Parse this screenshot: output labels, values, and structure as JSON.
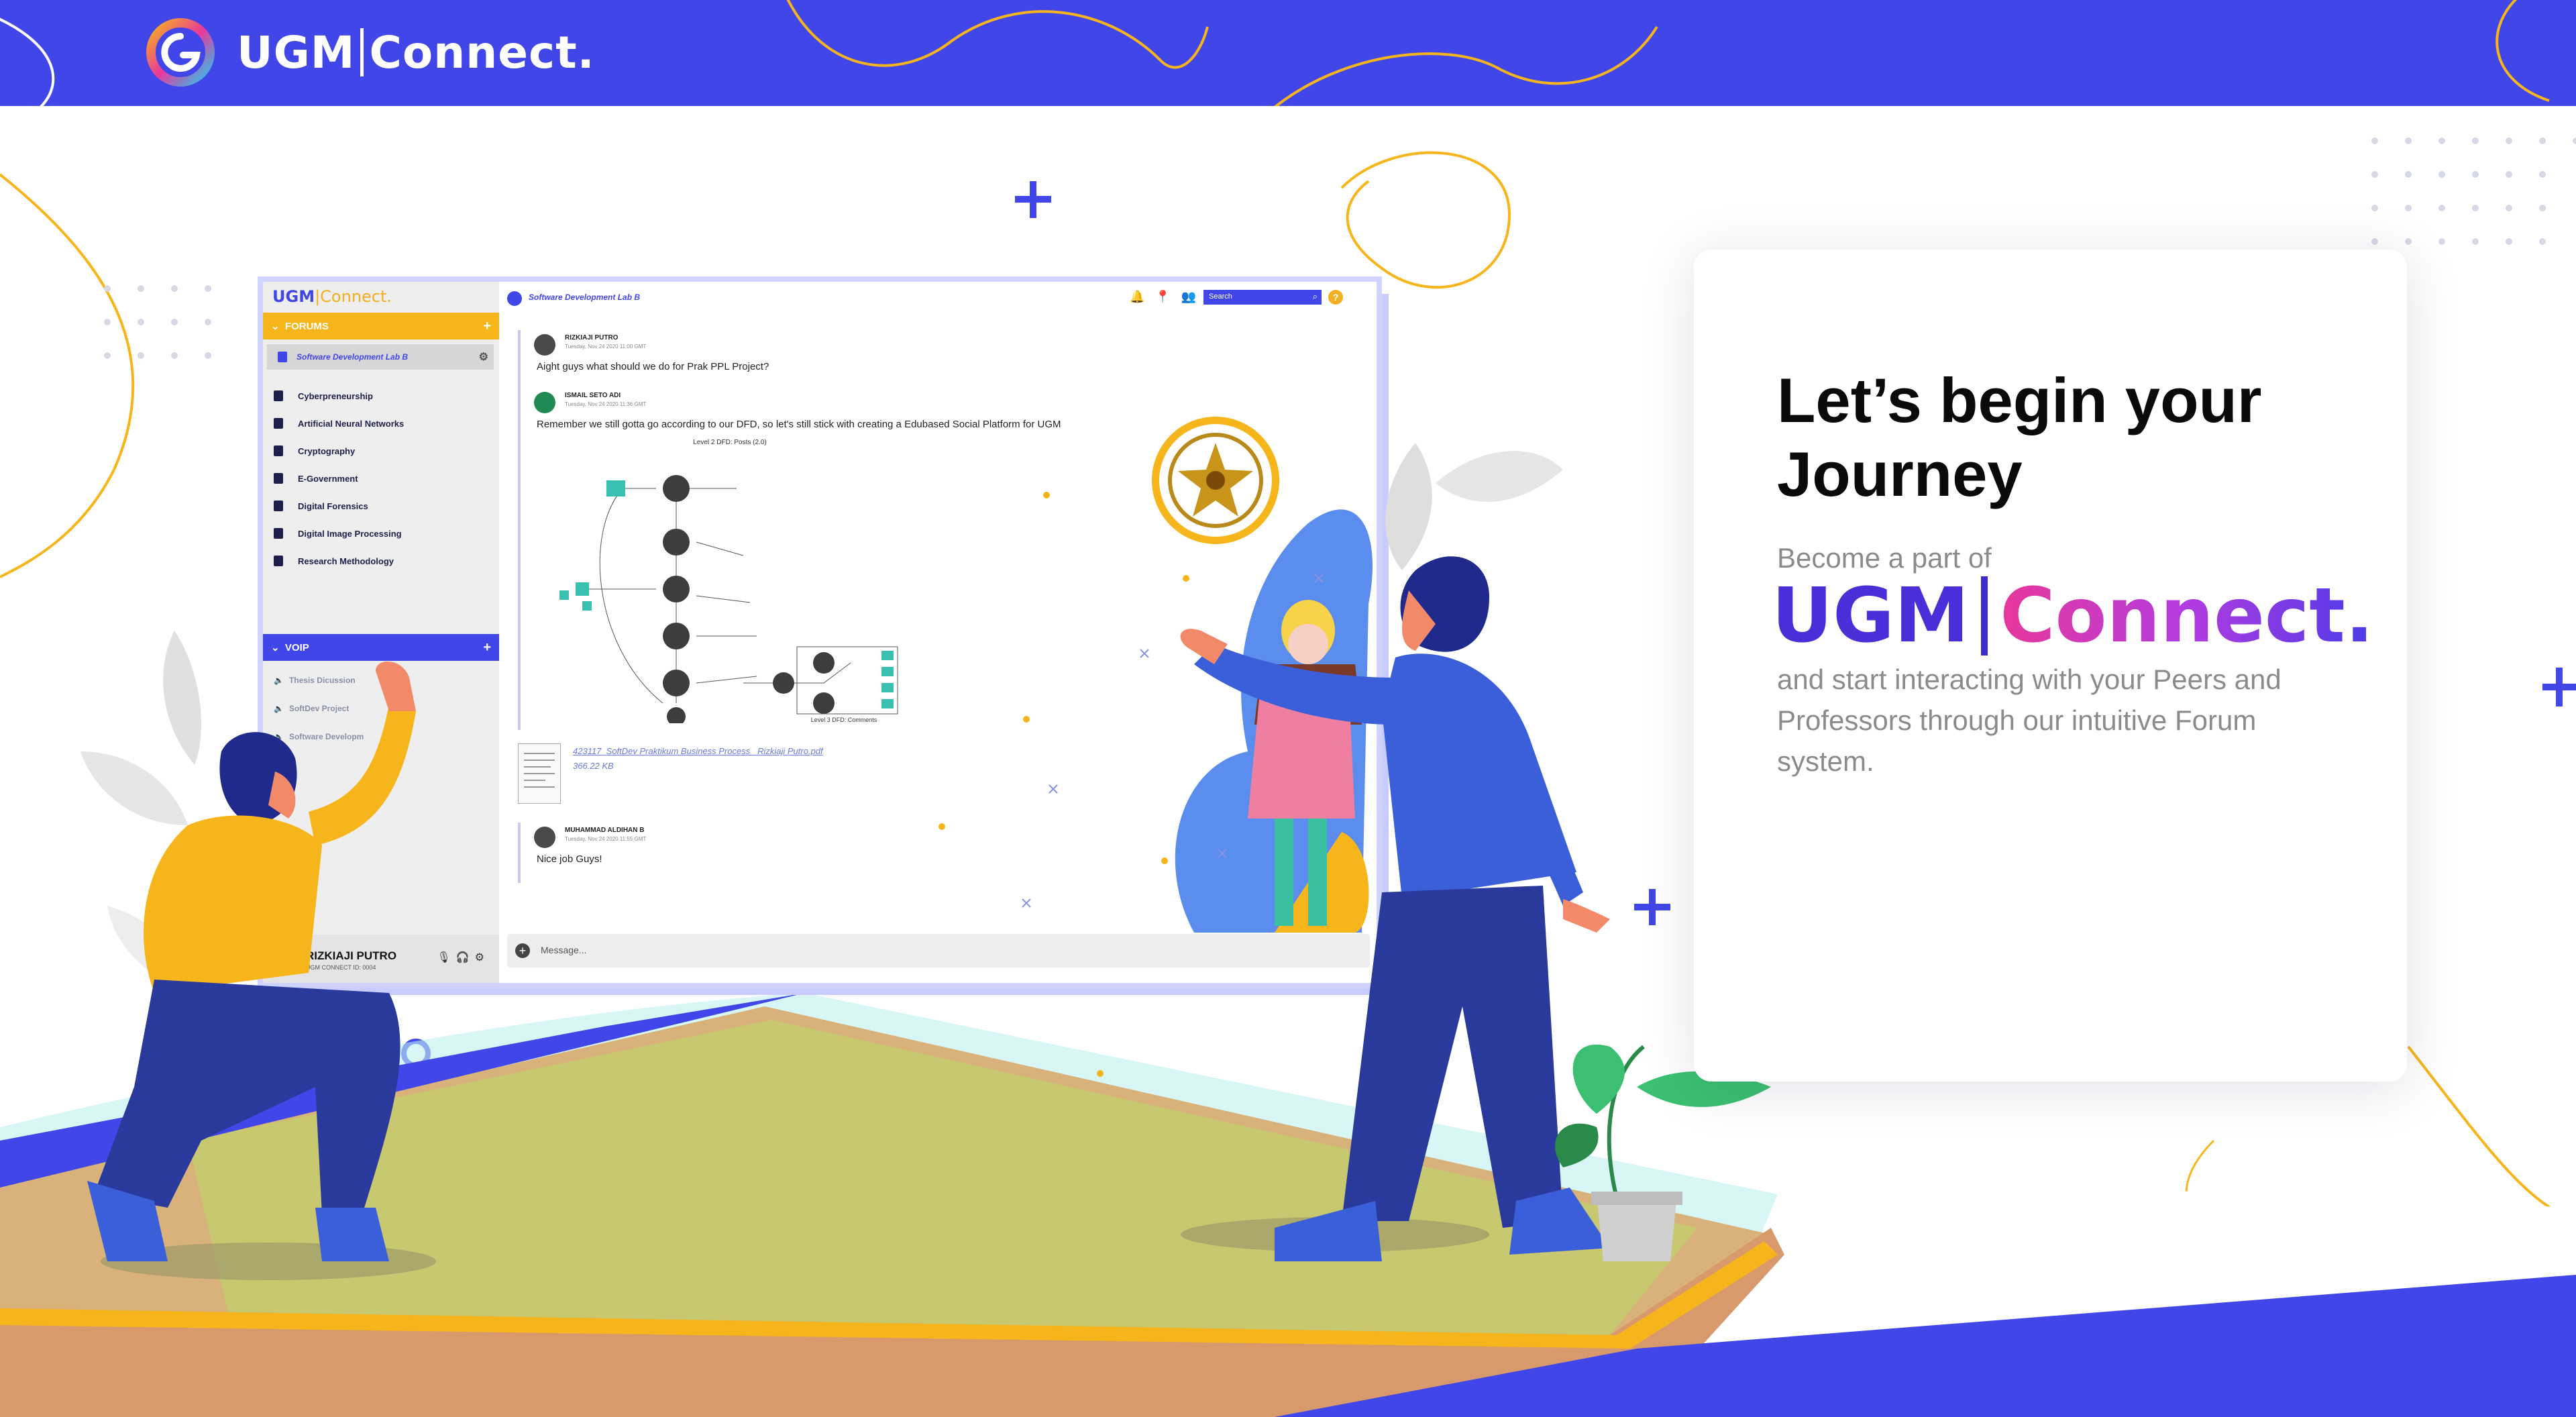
{
  "brand": {
    "name_left": "UGM",
    "name_right": "Connect."
  },
  "colors": {
    "primary": "#4146e8",
    "accent": "#f7b51c",
    "text_muted": "#8b8b8b"
  },
  "app": {
    "logo_left": "UGM",
    "logo_right": "Connect.",
    "forums_label": "FORUMS",
    "active_forum": "Software Development Lab B",
    "forums": [
      "Cyberpreneurship",
      "Artificial Neural Networks",
      "Cryptography",
      "E-Government",
      "Digital Forensics",
      "Digital Image Processing",
      "Research Methodology"
    ],
    "voip_label": "VOIP",
    "voip_channels": [
      "Thesis Dicussion",
      "SoftDev Project",
      "Software Developm"
    ],
    "user": {
      "name": "RIZKIAJI PUTRO",
      "id": "UGM CONNECT ID: 0004"
    },
    "channel_title": "Software Development Lab B",
    "search_placeholder": "Search",
    "messages": [
      {
        "author": "RIZKIAJI PUTRO",
        "time": "Tuesday, Nov 24 2020 11:00 GMT",
        "text": "Aight guys what should we do for Prak PPL Project?"
      },
      {
        "author": "ISMAIL SETO ADI",
        "time": "Tuesday, Nov 24 2020 11:36 GMT",
        "text": "Remember we still gotta go according to our DFD, so let's still stick with creating a Edubased Social Platform for UGM"
      },
      {
        "author": "MUHAMMAD ALDIHAN B",
        "time": "Tuesday, Nov 24 2020 11:55 GMT",
        "text": "Nice job Guys!"
      }
    ],
    "diagram_title": "Level 2 DFD: Posts (2.0)",
    "diagram_footer": "Level 3 DFD: Comments",
    "attachment": {
      "name": "423117_SoftDev Praktikum Business Process_ Rizkiaji Putro.pdf",
      "size": "366.22 KB"
    },
    "composer_placeholder": "Message..."
  },
  "card": {
    "headline": "Let’s begin your Journey",
    "pre_logo": "Become a part of",
    "logo_left": "UGM",
    "logo_right": "Connect.",
    "description": "and start interacting with your Peers and Professors through our intuitive Forum system."
  }
}
